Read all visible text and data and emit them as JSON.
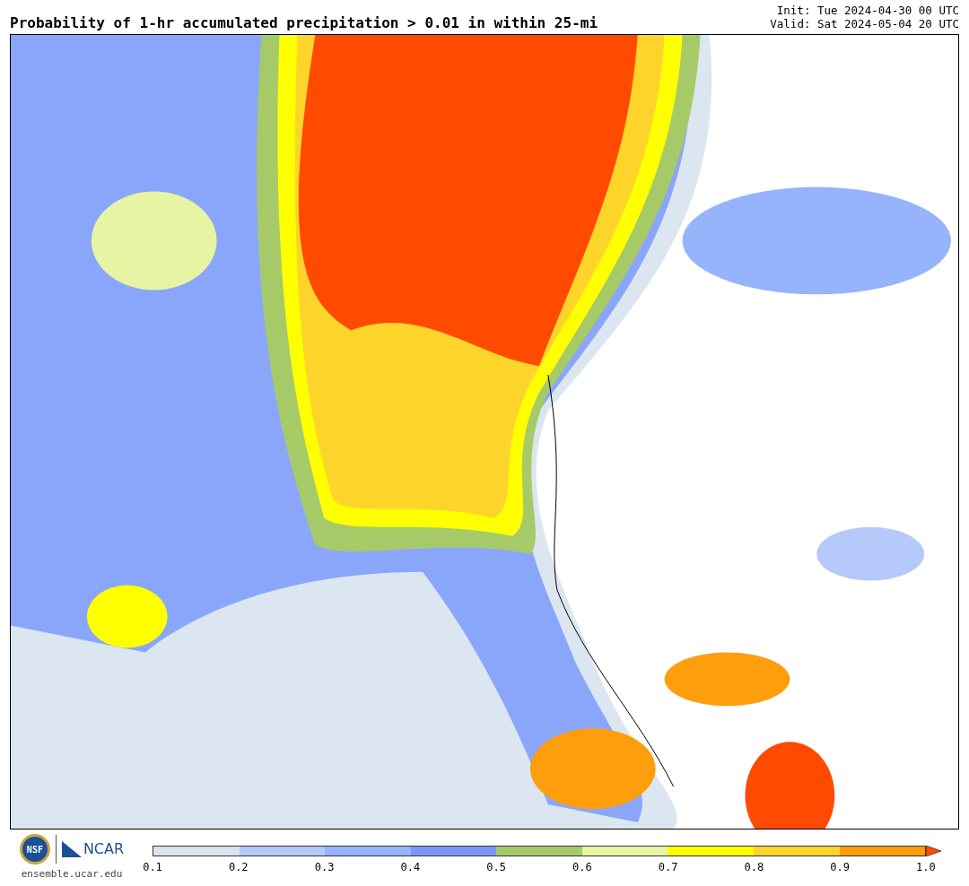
{
  "title": "Probability of 1-hr accumulated precipitation > 0.01 in within 25-mi",
  "run_info": [
    "Init: Tue 2024-04-30 00 UTC",
    "Valid: Sat 2024-05-04 20 UTC"
  ],
  "logos": {
    "seal_text": "NSF",
    "wordmark": "NCAR",
    "url": "ensemble.ucar.edu"
  },
  "colorbar": {
    "segments": [
      {
        "kind": "band",
        "color": "#d9e4ef"
      },
      {
        "kind": "band",
        "color": "#b5c9fb"
      },
      {
        "kind": "band",
        "color": "#96b3fb"
      },
      {
        "kind": "band",
        "color": "#7c95fa"
      },
      {
        "kind": "band",
        "color": "#a7ca69"
      },
      {
        "kind": "band",
        "color": "#e7f4a3"
      },
      {
        "kind": "band",
        "color": "#ffff00"
      },
      {
        "kind": "band",
        "color": "#fdd52a"
      },
      {
        "kind": "band",
        "color": "#ff9e0c"
      },
      {
        "kind": "arrow",
        "color": "#ff4a00"
      }
    ],
    "labels": [
      "0.1",
      "0.2",
      "0.3",
      "0.4",
      "0.5",
      "0.6",
      "0.7",
      "0.8",
      "0.9",
      "1.0"
    ]
  }
}
